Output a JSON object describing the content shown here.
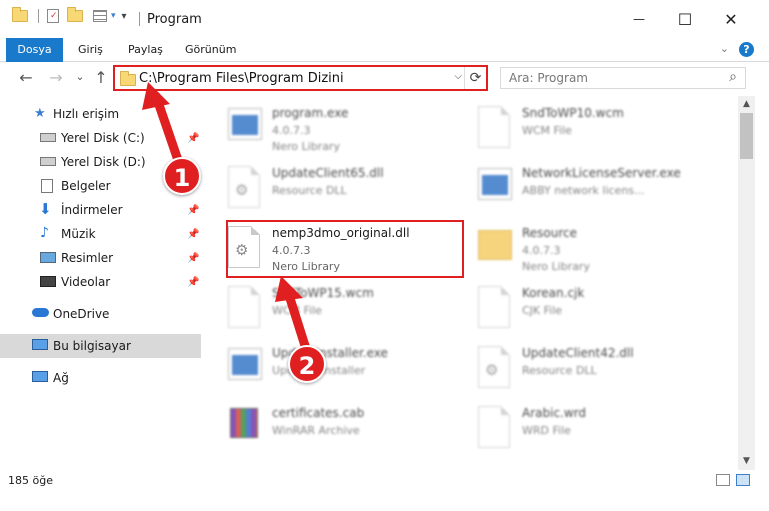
{
  "window": {
    "title": "Program",
    "minimize_glyph": "—",
    "maximize_glyph": "☐",
    "close_glyph": "✕"
  },
  "ribbon": {
    "tabs": [
      "Dosya",
      "Giriş",
      "Paylaş",
      "Görünüm"
    ],
    "help": "?"
  },
  "nav": {
    "back": "←",
    "forward": "→",
    "recent": "⌄",
    "up": "↑",
    "address": "C:\\Program Files\\Program Dizini",
    "search_placeholder": "Ara: Program"
  },
  "sidebar": {
    "items": [
      {
        "label": "Hızlı erişim",
        "icon": "star-icon"
      },
      {
        "label": "Yerel Disk (C:)",
        "icon": "drive-icon"
      },
      {
        "label": "Yerel Disk (D:)",
        "icon": "drive-icon"
      },
      {
        "label": "Belgeler",
        "icon": "documents-icon"
      },
      {
        "label": "İndirmeler",
        "icon": "download-icon"
      },
      {
        "label": "Müzik",
        "icon": "music-icon"
      },
      {
        "label": "Resimler",
        "icon": "pictures-icon"
      },
      {
        "label": "Videolar",
        "icon": "videos-icon"
      },
      {
        "label": "OneDrive",
        "icon": "cloud-icon"
      },
      {
        "label": "Bu bilgisayar",
        "icon": "computer-icon"
      },
      {
        "label": "Ağ",
        "icon": "network-icon"
      }
    ]
  },
  "files": [
    {
      "name": "program.exe",
      "line2": "4.0.7.3",
      "line3": "Nero Library",
      "icon": "app-icon"
    },
    {
      "name": "SndToWP10.wcm",
      "line2": "WCM File",
      "line3": "",
      "icon": "file-icon"
    },
    {
      "name": "UpdateClient65.dll",
      "line2": "Resource DLL",
      "line3": "",
      "icon": "dll-icon"
    },
    {
      "name": "NetworkLicenseServer.exe",
      "line2": "ABBY network licens...",
      "line3": "",
      "icon": "app-icon"
    },
    {
      "name": "nemp3dmo_original.dll",
      "line2": "4.0.7.3",
      "line3": "Nero Library",
      "icon": "dll-icon"
    },
    {
      "name": "Resource",
      "line2": "4.0.7.3",
      "line3": "Nero Library",
      "icon": "folder-icon"
    },
    {
      "name": "SndToWP15.wcm",
      "line2": "WCM File",
      "line3": "",
      "icon": "file-icon"
    },
    {
      "name": "Korean.cjk",
      "line2": "CJK File",
      "line3": "",
      "icon": "file-icon"
    },
    {
      "name": "UpdateInstaller.exe",
      "line2": "Updates installer",
      "line3": "",
      "icon": "app-icon"
    },
    {
      "name": "UpdateClient42.dll",
      "line2": "Resource DLL",
      "line3": "",
      "icon": "dll-icon"
    },
    {
      "name": "certificates.cab",
      "line2": "WinRAR Archive",
      "line3": "",
      "icon": "archive-icon"
    },
    {
      "name": "Arabic.wrd",
      "line2": "WRD File",
      "line3": "",
      "icon": "file-icon"
    }
  ],
  "annotations": {
    "step1": "1",
    "step2": "2"
  },
  "status": {
    "count": "185 öğe"
  },
  "colors": {
    "accent": "#1979ca",
    "highlight": "#e02020"
  }
}
